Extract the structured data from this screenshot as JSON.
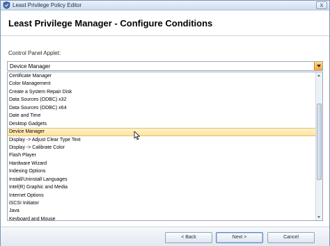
{
  "window": {
    "title": "Least Privilege Policy Editor",
    "close_glyph": "x"
  },
  "header": {
    "title": "Least Privilege Manager - Configure Conditions"
  },
  "form": {
    "applet_label": "Control Panel Applet:",
    "selected_value": "Device Manager"
  },
  "list": {
    "items": [
      "Certificate Manager",
      "Color Management",
      "Create a System Repair Disk",
      "Data Sources (ODBC) x32",
      "Data Sources (ODBC) x64",
      "Date and Time",
      "Desktop Gadgets",
      "Device Manager",
      "Display -> Adjust Clear Type Text",
      "Display -> Calibrate Color",
      "Flash Player",
      "Hardware Wizard",
      "Indexing Options",
      "Install/Uninstall Languages",
      "Intel(R) Graphic and Media",
      "Internet Options",
      "iSCSI Initiator",
      "Java",
      "Keyboard and Mouse"
    ],
    "selected_index": 7
  },
  "footer": {
    "back_label": "< Back",
    "next_label": "Next >",
    "cancel_label": "Cancel"
  },
  "icons": {
    "app": "shield-icon",
    "close": "close-icon",
    "dropdown": "chevron-down-icon",
    "cursor": "mouse-pointer-icon"
  },
  "colors": {
    "selection": "#ffe3a0",
    "accent": "#f3a640",
    "frame": "#7a96b8"
  }
}
